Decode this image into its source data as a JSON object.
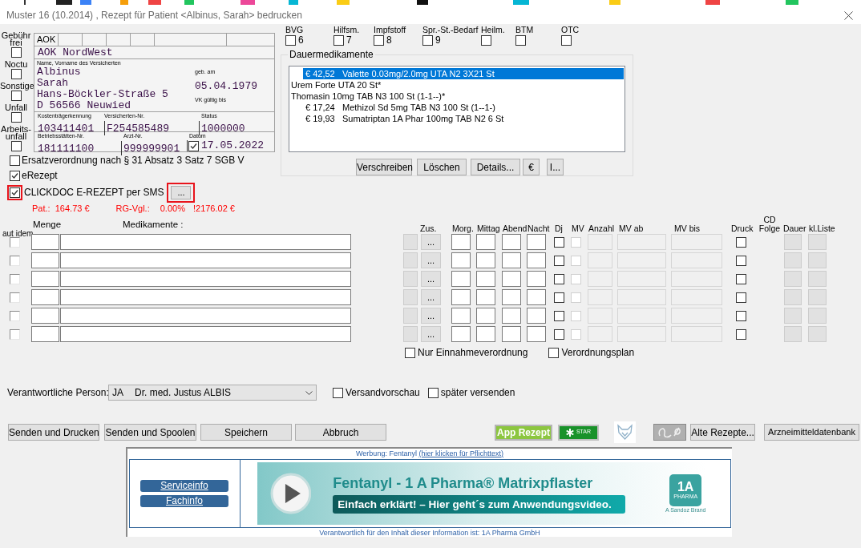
{
  "window": {
    "title": "Muster 16 (10.2014) , Rezept für Patient <Albinus, Sarah> bedrucken"
  },
  "flags": [
    {
      "label": "Gebühr frei",
      "checked": false
    },
    {
      "label": "Noctu",
      "checked": false
    },
    {
      "label": "Sonstige",
      "checked": false
    },
    {
      "label": "Unfall",
      "checked": false
    },
    {
      "label": "Arbeits-unfall",
      "checked": false
    }
  ],
  "form": {
    "kasse_code": "AOK",
    "kasse_name": "AOK NordWest",
    "name_label": "Name, Vorname des Versicherten",
    "last_name": "Albinus",
    "first_name": "Sarah",
    "street": "Hans-Böckler-Straße 5",
    "city": "D 56566 Neuwied",
    "dob_label": "geb. am",
    "dob": "05.04.1979",
    "vk_label": "VK gültig bis",
    "kostentraeger_label": "Kostenträgerkennung",
    "kostentraeger": "103411401",
    "versicherten_nr_label": "Versicherten-Nr.",
    "versicherten_nr": "F254585489",
    "status_label": "Status",
    "status": "1000000",
    "bsnr_label": "Betriebsstätten-Nr.",
    "bsnr": "181111100",
    "arzt_nr_label": "Arzt-Nr.",
    "arzt_nr": "999999901",
    "datum_label": "Datum",
    "datum_checked": true,
    "datum": "17.05.2022"
  },
  "options": [
    {
      "label": "Ersatzverordnung nach § 31 Absatz 3 Satz 7 SGB V",
      "checked": false,
      "highlighted": false
    },
    {
      "label": "eRezept",
      "checked": true,
      "highlighted": false
    },
    {
      "label": "CLICKDOC E-REZEPT per SMS",
      "checked": true,
      "highlighted": true,
      "button": "..."
    }
  ],
  "totals": [
    "Pat.:  164.73 €",
    "RG-Vgl.:",
    "0.00%",
    "!2176.02 €"
  ],
  "categories": [
    {
      "label": "BVG",
      "number": "6",
      "checked": false
    },
    {
      "label": "Hilfsm.",
      "number": "7",
      "checked": false
    },
    {
      "label": "Impfstoff",
      "number": "8",
      "checked": false
    },
    {
      "label": "Spr.-St.-Bedarf",
      "number": "9",
      "checked": false
    },
    {
      "label": "Heilm.",
      "checked": false
    },
    {
      "label": "BTM",
      "checked": false
    },
    {
      "label": "OTC",
      "checked": false
    }
  ],
  "dauermedikamente": {
    "title": "Dauermedikamente",
    "items": [
      {
        "price": "€ 42,52",
        "name": "Valette 0.03mg/2.0mg UTA N2 3X21 St",
        "selected": true
      },
      {
        "name": "Urem Forte UTA 20 St*",
        "selected": false
      },
      {
        "name": "Thomasin 10mg TAB N3 100 St (1-1--)*",
        "selected": false
      },
      {
        "price": "€ 17,24",
        "name": "Methizol Sd 5mg TAB N3 100 St (1--1-)",
        "selected": false
      },
      {
        "price": "€ 19,93",
        "name": "Sumatriptan 1A Phar 100mg TAB N2 6 St",
        "selected": false
      }
    ],
    "buttons": [
      "Verschreiben",
      "Löschen",
      "Details...",
      "€",
      "I..."
    ]
  },
  "prescription_grid": {
    "headers": {
      "aut_idem": "aut idem",
      "menge": "Menge",
      "medikamente": "Medikamente :",
      "zus": "Zus.",
      "morg": "Morg.",
      "mittag": "Mittag",
      "abend": "Abend",
      "nacht": "Nacht",
      "dj": "Dj",
      "mv": "MV",
      "anzahl": "Anzahl",
      "mv_ab": "MV ab",
      "mv_bis": "MV bis",
      "druck": "Druck",
      "cd_folge": "CD Folge",
      "dauer": "Dauer",
      "kl_liste": "kl.Liste"
    },
    "rows": [
      {
        "aut_idem": false,
        "dj": false,
        "mv": false,
        "druck": false,
        "button": "..."
      },
      {
        "aut_idem": false,
        "dj": false,
        "mv": false,
        "druck": false,
        "button": "..."
      },
      {
        "aut_idem": false,
        "dj": false,
        "mv": false,
        "druck": false,
        "button": "..."
      },
      {
        "aut_idem": false,
        "dj": false,
        "mv": false,
        "druck": false,
        "button": "..."
      },
      {
        "aut_idem": false,
        "dj": false,
        "mv": false,
        "druck": false,
        "button": "..."
      },
      {
        "aut_idem": false,
        "dj": false,
        "mv": false,
        "druck": false,
        "button": "..."
      }
    ]
  },
  "plan_options": [
    {
      "label": "Nur Einnahmeverordnung",
      "checked": false
    },
    {
      "label": "Verordnungsplan",
      "checked": false
    }
  ],
  "responsible": {
    "label": "Verantwortliche Person:",
    "code": "JA",
    "name": "Dr. med. Justus ALBIS"
  },
  "send_options": [
    {
      "label": "Versandvorschau",
      "checked": false
    },
    {
      "label": "später versenden",
      "checked": false
    }
  ],
  "main_buttons": [
    "Senden und Drucken",
    "Senden und Spoolen",
    "Speichern",
    "Abbruch"
  ],
  "tool_buttons": [
    {
      "kind": "app",
      "label": "App Rezept"
    },
    {
      "kind": "star",
      "label": "STAR"
    },
    {
      "kind": "fox"
    },
    {
      "kind": "signature"
    },
    {
      "kind": "text",
      "label": "Alte Rezepte..."
    },
    {
      "kind": "text",
      "label": "Arzneimitteldatenbank"
    }
  ],
  "ad": {
    "header": "Werbung: Fentanyl",
    "header_link": "(hier klicken für Pflichttext)",
    "links": [
      "Serviceinfo",
      "Fachinfo"
    ],
    "headline": "Fentanyl - 1 A Pharma® Matrixpflaster",
    "cta": "Einfach erklärt! – Hier geht´s zum Anwendungsvideo.",
    "logo": "1A",
    "logo_sub": "PHARMA",
    "brand": "A Sandoz Brand",
    "footer": "Verantwortlich für den Inhalt dieser Information ist: 1A Pharma GmbH"
  }
}
